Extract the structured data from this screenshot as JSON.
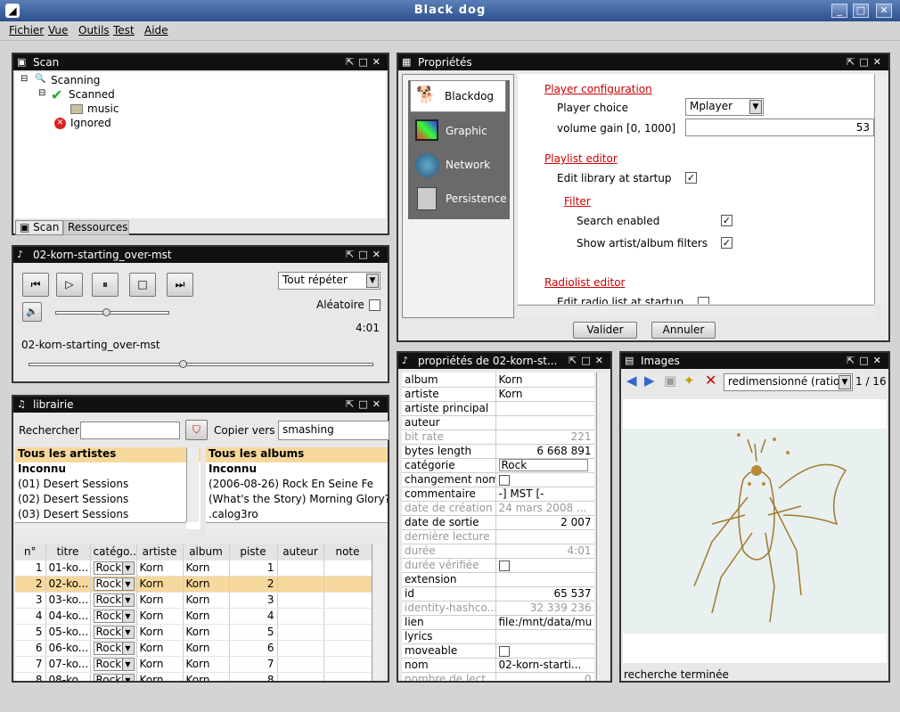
{
  "window": {
    "title": "Black dog"
  },
  "menu": [
    "Fichier",
    "Vue",
    "Outils",
    "Test",
    "Aide"
  ],
  "scan": {
    "title": "Scan",
    "tree": {
      "scanning": "Scanning",
      "scanned": "Scanned",
      "music": "music",
      "ignored": "Ignored"
    },
    "tabs": [
      "Scan",
      "Ressources"
    ]
  },
  "player": {
    "title": "02-korn-starting_over-mst",
    "repeat": "Tout répéter",
    "random_label": "Aléatoire",
    "time": "4:01",
    "track": "02-korn-starting_over-mst",
    "volume_level": 0.45,
    "position_level": 0.45
  },
  "library": {
    "title": "librairie",
    "search_label": "Rechercher",
    "search_value": "",
    "copy_label": "Copier vers",
    "copy_value": "smashing",
    "artists_header": "Tous les artistes",
    "artists": [
      "Inconnu",
      "(01) Desert Sessions",
      "(02) Desert Sessions",
      "(03) Desert Sessions"
    ],
    "albums_header": "Tous les albums",
    "albums": [
      "Inconnu",
      "(2006-08-26) Rock En Seine Fe",
      "(What's the Story) Morning Glory?",
      ".calog3ro"
    ],
    "columns": [
      "n°",
      "titre",
      "catégo...",
      "artiste",
      "album",
      "piste",
      "auteur",
      "note"
    ],
    "rows": [
      [
        "1",
        "01-ko...",
        "Rock",
        "Korn",
        "Korn",
        "1"
      ],
      [
        "2",
        "02-ko...",
        "Rock",
        "Korn",
        "Korn",
        "2"
      ],
      [
        "3",
        "03-ko...",
        "Rock",
        "Korn",
        "Korn",
        "3"
      ],
      [
        "4",
        "04-ko...",
        "Rock",
        "Korn",
        "Korn",
        "4"
      ],
      [
        "5",
        "05-ko...",
        "Rock",
        "Korn",
        "Korn",
        "5"
      ],
      [
        "6",
        "06-ko...",
        "Rock",
        "Korn",
        "Korn",
        "6"
      ],
      [
        "7",
        "07-ko...",
        "Rock",
        "Korn",
        "Korn",
        "7"
      ],
      [
        "8",
        "08-ko...",
        "Rock",
        "Korn",
        "Korn",
        "8"
      ]
    ]
  },
  "props": {
    "title": "Propriétés",
    "categories": [
      "Blackdog",
      "Graphic",
      "Network",
      "Persistence"
    ],
    "player_config": "Player configuration",
    "player_choice_label": "Player choice",
    "player_choice": "Mplayer",
    "volume_gain_label": "volume gain [0, 1000]",
    "volume_gain_value": "53",
    "playlist_editor": "Playlist editor",
    "edit_library": "Edit library at startup",
    "filter": "Filter",
    "search_enabled": "Search enabled",
    "show_filters": "Show artist/album filters",
    "radiolist_editor": "Radiolist editor",
    "edit_radio": "Edit radio list at startup",
    "ok": "Valider",
    "cancel": "Annuler"
  },
  "trackprops": {
    "title": "propriétés de 02-korn-st...",
    "rows": [
      [
        "album",
        "Korn"
      ],
      [
        "artiste",
        "Korn"
      ],
      [
        "artiste principal",
        ""
      ],
      [
        "auteur",
        ""
      ],
      [
        "bit rate",
        "221"
      ],
      [
        "bytes length",
        "6 668 891"
      ],
      [
        "catégorie",
        "Rock"
      ],
      [
        "changement nom",
        ""
      ],
      [
        "commentaire",
        "-] MST [-"
      ],
      [
        "date de création",
        "24 mars 2008 ..."
      ],
      [
        "date de sortie",
        "2 007"
      ],
      [
        "dernière lecture",
        ""
      ],
      [
        "durée",
        "4:01"
      ],
      [
        "durée vérifiée",
        ""
      ],
      [
        "extension",
        ""
      ],
      [
        "id",
        "65 537"
      ],
      [
        "identity-hashco...",
        "32 339 236"
      ],
      [
        "lien",
        "file:/mnt/data/mu"
      ],
      [
        "lyrics",
        ""
      ],
      [
        "moveable",
        ""
      ],
      [
        "nom",
        "02-korn-starti..."
      ],
      [
        "nombre de lect...",
        "0"
      ]
    ]
  },
  "images": {
    "title": "Images",
    "mode": "redimensionné (ratio)",
    "page": "1 / 16",
    "status": "recherche terminée"
  }
}
